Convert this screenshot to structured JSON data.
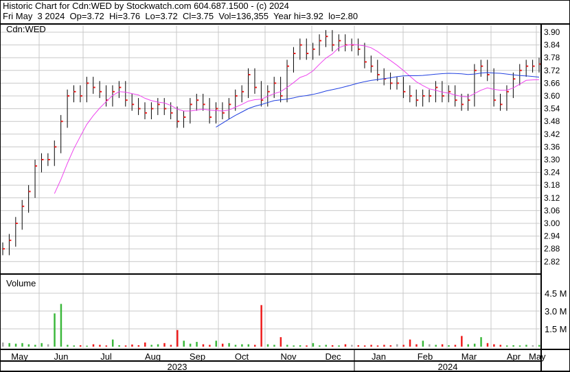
{
  "header": {
    "line1": "Historic Chart for Cdn:WED by Stockwatch.com 604.687.1500 - (c) 2024",
    "line2": "Fri May  3 2024  Op=3.72  Hi=3.76  Lo=3.72  Cl=3.75  Vol=136,355  Year hi=3.92  lo=2.80"
  },
  "chart_data": {
    "type": "ohlc",
    "title": "Cdn:WED",
    "volume_label": "Volume",
    "ylim": [
      2.77,
      3.93
    ],
    "y_ticks": [
      "3.90",
      "3.84",
      "3.78",
      "3.72",
      "3.66",
      "3.60",
      "3.54",
      "3.48",
      "3.42",
      "3.36",
      "3.30",
      "3.24",
      "3.18",
      "3.12",
      "3.06",
      "3.00",
      "2.94",
      "2.88",
      "2.82"
    ],
    "volume_ticks": [
      "4.5 M",
      "3.0 M",
      "1.5 M"
    ],
    "volume_ylim_millions": [
      0,
      5.5
    ],
    "months": [
      "May",
      "Jun",
      "Jul",
      "Aug",
      "Sep",
      "Oct",
      "Nov",
      "Dec",
      "Jan",
      "Feb",
      "Mar",
      "Apr",
      "May"
    ],
    "years": [
      "2023",
      "2024"
    ],
    "ma_periods_points": [
      9,
      34
    ],
    "colors": {
      "up": "#3cb83c",
      "down": "#ee1c1c",
      "flat": "#a8a8a8",
      "ma_short": "#ee44ee",
      "ma_long": "#1f3fe0",
      "grid": "#c8c8c8"
    },
    "closes": [
      2.88,
      2.92,
      3.0,
      3.08,
      3.15,
      3.27,
      3.3,
      3.3,
      3.36,
      3.48,
      3.6,
      3.62,
      3.6,
      3.66,
      3.64,
      3.62,
      3.58,
      3.62,
      3.64,
      3.58,
      3.56,
      3.54,
      3.52,
      3.54,
      3.56,
      3.54,
      3.52,
      3.48,
      3.5,
      3.56,
      3.58,
      3.56,
      3.5,
      3.54,
      3.52,
      3.56,
      3.6,
      3.62,
      3.7,
      3.64,
      3.58,
      3.62,
      3.66,
      3.6,
      3.74,
      3.8,
      3.84,
      3.8,
      3.82,
      3.86,
      3.88,
      3.84,
      3.86,
      3.84,
      3.84,
      3.82,
      3.76,
      3.74,
      3.7,
      3.68,
      3.66,
      3.66,
      3.62,
      3.6,
      3.58,
      3.6,
      3.6,
      3.64,
      3.6,
      3.62,
      3.58,
      3.56,
      3.58,
      3.72,
      3.74,
      3.7,
      3.58,
      3.56,
      3.62,
      3.68,
      3.72,
      3.74,
      3.74,
      3.75
    ],
    "volumes_millions": [
      0.35,
      0.3,
      0.25,
      0.3,
      0.2,
      0.15,
      0.3,
      0.2,
      2.8,
      3.6,
      0.15,
      0.1,
      0.12,
      0.08,
      0.2,
      0.15,
      0.1,
      0.6,
      0.12,
      0.1,
      0.18,
      0.12,
      0.35,
      0.15,
      0.2,
      0.3,
      0.15,
      1.4,
      0.5,
      0.25,
      0.4,
      0.2,
      0.15,
      0.5,
      0.25,
      0.3,
      0.15,
      0.2,
      0.2,
      0.15,
      3.5,
      0.2,
      0.15,
      0.8,
      0.15,
      0.1,
      0.12,
      0.1,
      0.3,
      0.1,
      0.15,
      0.12,
      0.1,
      0.2,
      0.15,
      0.12,
      0.1,
      0.15,
      0.1,
      0.15,
      0.12,
      0.2,
      0.15,
      0.6,
      0.2,
      0.5,
      0.2,
      0.15,
      0.2,
      0.12,
      0.15,
      0.9,
      0.2,
      0.25,
      0.8,
      0.3,
      0.2,
      0.15,
      0.1,
      0.12,
      0.1,
      0.15,
      0.12,
      0.14
    ]
  }
}
